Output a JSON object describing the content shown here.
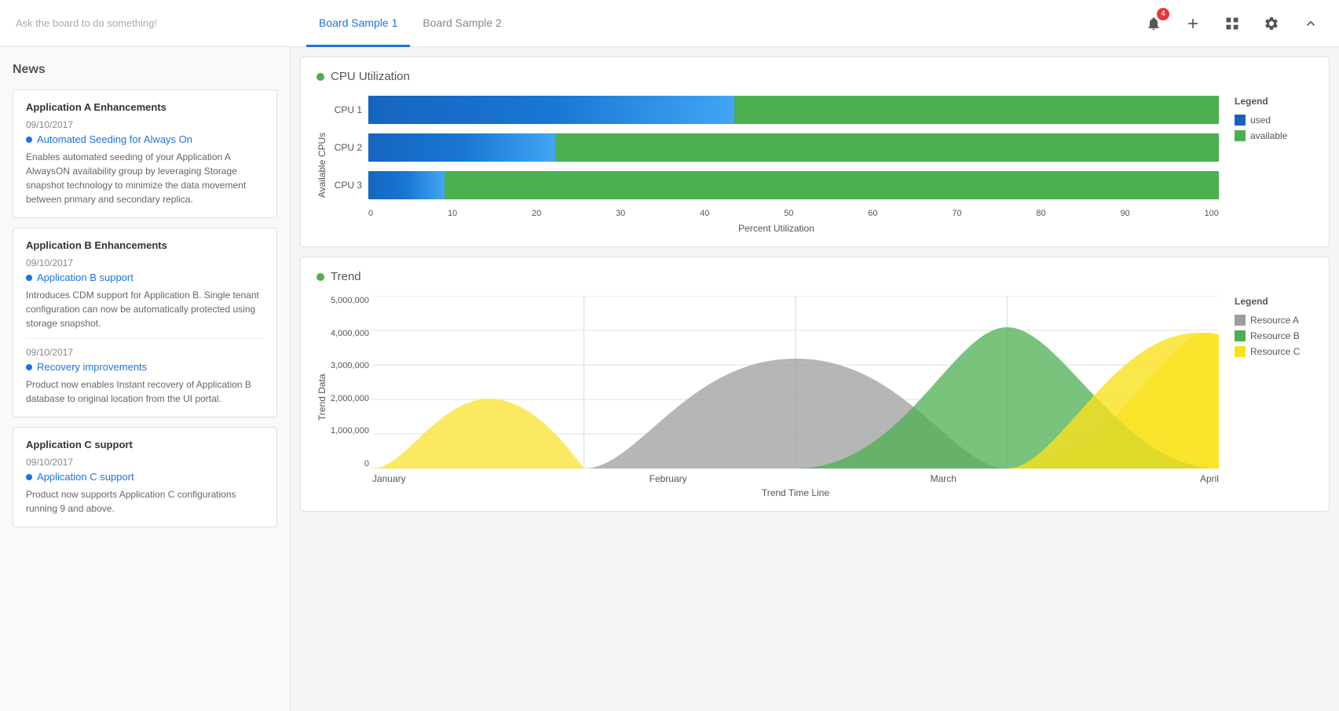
{
  "topbar": {
    "ask_placeholder": "Ask the board to do something!",
    "tabs": [
      {
        "id": "tab1",
        "label": "Board Sample 1",
        "active": true
      },
      {
        "id": "tab2",
        "label": "Board Sample 2",
        "active": false
      }
    ],
    "notification_count": "4",
    "icons": {
      "bell": "🔔",
      "add": "+",
      "grid": "⊞",
      "gear": "⚙",
      "chevron": "⌃"
    }
  },
  "sidebar": {
    "section_title": "News",
    "cards": [
      {
        "title": "Application A Enhancements",
        "items": [
          {
            "date": "09/10/2017",
            "label": "Automated Seeding for Always On",
            "description": "Enables automated seeding of your Application A AlwaysON availability group by leveraging Storage snapshot technology to minimize the data movement between primary and secondary replica."
          }
        ]
      },
      {
        "title": "Application B Enhancements",
        "items": [
          {
            "date": "09/10/2017",
            "label": "Application B support",
            "description": "Introduces CDM support for Application B. Single tenant configuration can now be automatically protected using storage snapshot."
          },
          {
            "date": "09/10/2017",
            "label": "Recovery improvements",
            "description": "Product now enables Instant recovery of Application B database to original location from the UI portal."
          }
        ]
      },
      {
        "title": "Application C support",
        "items": [
          {
            "date": "09/10/2017",
            "label": "Application C support",
            "description": "Product now supports Application C configurations running 9 and above."
          }
        ]
      }
    ]
  },
  "cpu_chart": {
    "title": "CPU Utilization",
    "y_axis_label": "Available CPUs",
    "x_axis_label": "Percent Utilization",
    "x_ticks": [
      "0",
      "10",
      "20",
      "30",
      "40",
      "50",
      "60",
      "70",
      "80",
      "90",
      "100"
    ],
    "bars": [
      {
        "label": "CPU 1",
        "used_pct": 43,
        "available_pct": 57
      },
      {
        "label": "CPU 2",
        "used_pct": 22,
        "available_pct": 78
      },
      {
        "label": "CPU 3",
        "used_pct": 9,
        "available_pct": 91
      }
    ],
    "legend": {
      "title": "Legend",
      "items": [
        {
          "color": "#1565c0",
          "label": "used"
        },
        {
          "color": "#4caf50",
          "label": "available"
        }
      ]
    }
  },
  "trend_chart": {
    "title": "Trend",
    "y_axis_label": "Trend Data",
    "x_axis_label": "Trend Time Line",
    "x_ticks": [
      "January",
      "February",
      "March",
      "April"
    ],
    "y_ticks": [
      "0",
      "1,000,000",
      "2,000,000",
      "3,000,000",
      "4,000,000",
      "5,000,000"
    ],
    "legend": {
      "title": "Legend",
      "items": [
        {
          "color": "#9e9e9e",
          "label": "Resource A"
        },
        {
          "color": "#4caf50",
          "label": "Resource B"
        },
        {
          "color": "#f9e11e",
          "label": "Resource C"
        }
      ]
    }
  }
}
